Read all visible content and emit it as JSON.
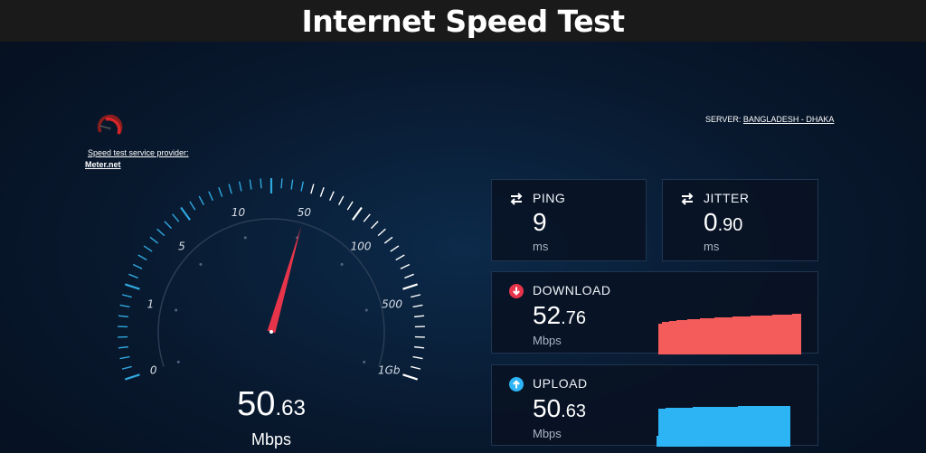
{
  "header": {
    "title": "Internet Speed Test"
  },
  "provider": {
    "label": "Speed test service provider:",
    "name": "Meter.net"
  },
  "server": {
    "label": "SERVER:",
    "name": "BANGLADESH - DHAKA"
  },
  "gauge": {
    "scale_labels": [
      "0",
      "1",
      "5",
      "10",
      "50",
      "100",
      "500",
      "1Gb"
    ],
    "needle_value_mbps": 50.63,
    "accent_color": "#2fa8e0",
    "needle_color": "#e8344a"
  },
  "speed": {
    "value_int": "50",
    "value_dec": ".63",
    "unit": "Mbps"
  },
  "ping": {
    "label": "PING",
    "value_int": "9",
    "unit": "ms",
    "icon": "swap-arrows-icon"
  },
  "jitter": {
    "label": "JITTER",
    "value_int": "0",
    "value_dec": ".90",
    "unit": "ms",
    "icon": "swap-arrows-icon"
  },
  "download": {
    "label": "DOWNLOAD",
    "value_int": "52",
    "value_dec": ".76",
    "unit": "Mbps",
    "icon": "download-arrow-icon",
    "color": "#f45b5b"
  },
  "upload": {
    "label": "UPLOAD",
    "value_int": "50",
    "value_dec": ".63",
    "unit": "Mbps",
    "icon": "upload-arrow-icon",
    "color": "#2db4f5"
  }
}
